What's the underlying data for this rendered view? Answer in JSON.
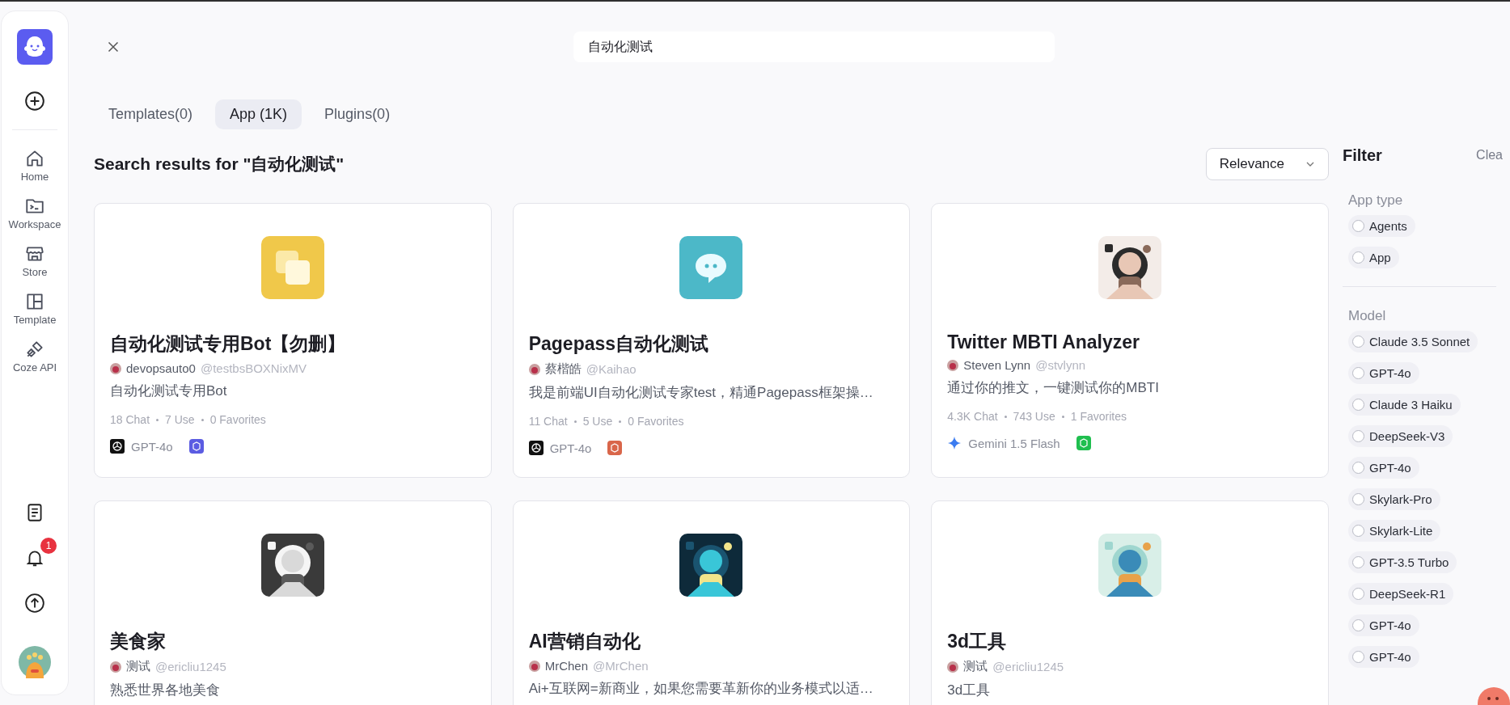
{
  "sidebar": {
    "nav": [
      {
        "label": "Home",
        "selected": false
      },
      {
        "label": "Workspace",
        "selected": false
      },
      {
        "label": "Store",
        "selected": false
      },
      {
        "label": "Template",
        "selected": false
      },
      {
        "label": "Coze API",
        "selected": false
      }
    ],
    "notification_badge": "1"
  },
  "search": {
    "value": "自动化测试"
  },
  "tabs": [
    {
      "label": "Templates(0)",
      "selected": false
    },
    {
      "label": "App (1K)",
      "selected": true
    },
    {
      "label": "Plugins(0)",
      "selected": false
    }
  ],
  "results_title": "Search results for \"自动化测试\"",
  "sort": {
    "value": "Relevance"
  },
  "cards": [
    {
      "kind": "squares",
      "title": "自动化测试专用Bot【勿删】",
      "author": "devopsauto0",
      "handle": "@testbsBOXNixMV",
      "description": "自动化测试专用Bot",
      "stats": [
        "18 Chat",
        "7 Use",
        "0 Favorites"
      ],
      "model": {
        "kind": "openai",
        "name": "GPT-4o"
      },
      "plugin": {
        "color": "#5b5ce2"
      }
    },
    {
      "kind": "bubble",
      "title": "Pagepass自动化测试",
      "author": "蔡楷皓",
      "handle": "@Kaihao",
      "description": "我是前端UI自动化测试专家test，精通Pagepass框架操…",
      "stats": [
        "11 Chat",
        "5 Use",
        "0 Favorites"
      ],
      "model": {
        "kind": "openai",
        "name": "GPT-4o"
      },
      "plugin": {
        "color": "#d9664a"
      }
    },
    {
      "kind": "picture",
      "title": "Twitter MBTI Analyzer",
      "author": "Steven Lynn",
      "handle": "@stvlynn",
      "description": "通过你的推文，一键测试你的MBTI",
      "stats": [
        "4.3K Chat",
        "743 Use",
        "1 Favorites"
      ],
      "model": {
        "kind": "gemini",
        "name": "Gemini 1.5 Flash"
      },
      "plugin": {
        "color": "#1fbf4f"
      }
    },
    {
      "kind": "picture",
      "title": "美食家",
      "author": "测试",
      "handle": "@ericliu1245",
      "description": "熟悉世界各地美食"
    },
    {
      "kind": "picture",
      "title": "AI营销自动化",
      "author": "MrChen",
      "handle": "@MrChen",
      "description": "Ai+互联网=新商业，如果您需要革新你的业务模式以适…"
    },
    {
      "kind": "picture",
      "title": "3d工具",
      "author": "测试",
      "handle": "@ericliu1245",
      "description": "3d工具"
    }
  ],
  "filter": {
    "title": "Filter",
    "clear": "Clea",
    "sections": [
      {
        "label": "App type",
        "options": [
          {
            "label": "Agents",
            "checked": false
          },
          {
            "label": "App",
            "checked": false
          }
        ]
      },
      {
        "label": "Model",
        "options": [
          {
            "label": "Claude 3.5 Sonnet",
            "checked": false
          },
          {
            "label": "GPT-4o",
            "checked": false
          },
          {
            "label": "Claude 3 Haiku",
            "checked": false
          },
          {
            "label": "DeepSeek-V3",
            "checked": false
          },
          {
            "label": "GPT-4o",
            "checked": false
          },
          {
            "label": "Skylark-Pro",
            "checked": false
          },
          {
            "label": "Skylark-Lite",
            "checked": false
          },
          {
            "label": "GPT-3.5 Turbo",
            "checked": false
          },
          {
            "label": "DeepSeek-R1",
            "checked": false
          },
          {
            "label": "GPT-4o",
            "checked": false
          },
          {
            "label": "GPT-4o",
            "checked": false
          }
        ]
      }
    ]
  }
}
